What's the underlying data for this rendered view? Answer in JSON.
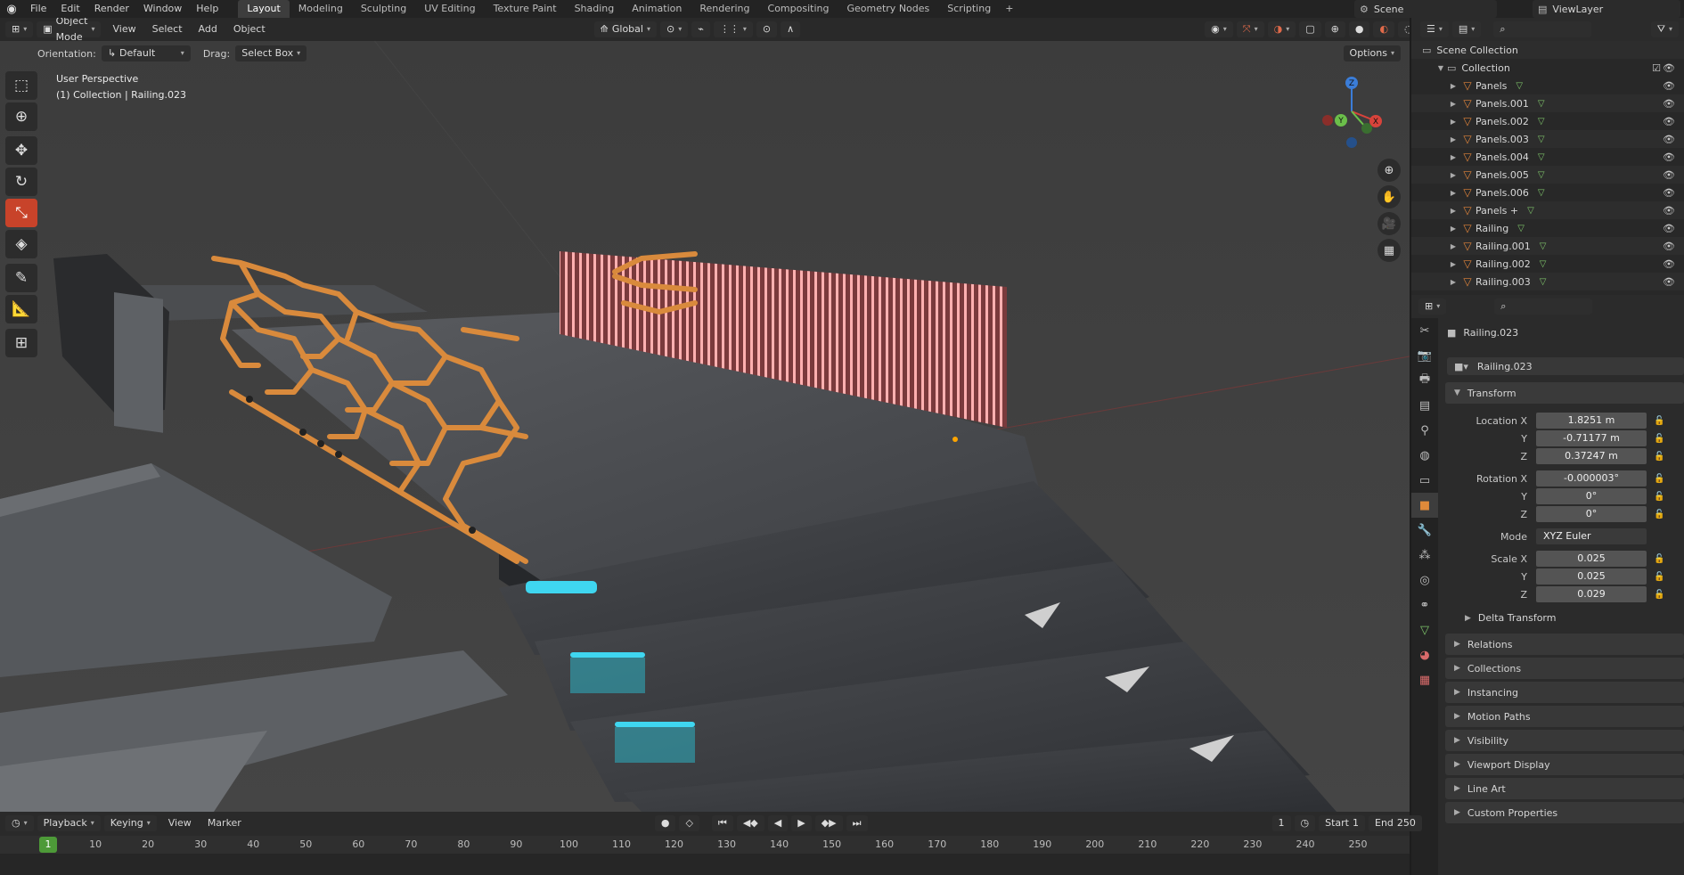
{
  "topbar": {
    "menus": [
      "File",
      "Edit",
      "Render",
      "Window",
      "Help"
    ],
    "workspaces": [
      "Layout",
      "Modeling",
      "Sculpting",
      "UV Editing",
      "Texture Paint",
      "Shading",
      "Animation",
      "Rendering",
      "Compositing",
      "Geometry Nodes",
      "Scripting"
    ],
    "active_workspace": "Layout",
    "scene": "Scene",
    "view_layer": "ViewLayer"
  },
  "viewport": {
    "mode": "Object Mode",
    "menus": [
      "View",
      "Select",
      "Add",
      "Object"
    ],
    "transform_orientation": "Global",
    "orientation_label": "Orientation:",
    "orientation_value": "Default",
    "drag_label": "Drag:",
    "drag_value": "Select Box",
    "options_label": "Options",
    "overlay_line1": "User Perspective",
    "overlay_line2": "(1) Collection | Railing.023",
    "gizmo_axes": [
      "X",
      "Y",
      "Z"
    ]
  },
  "outliner": {
    "root": "Scene Collection",
    "collection": "Collection",
    "items": [
      "Panels",
      "Panels.001",
      "Panels.002",
      "Panels.003",
      "Panels.004",
      "Panels.005",
      "Panels.006",
      "Panels +",
      "Railing",
      "Railing.001",
      "Railing.002",
      "Railing.003"
    ]
  },
  "properties": {
    "object_name": "Railing.023",
    "object_name_field": "Railing.023",
    "transform_header": "Transform",
    "location": {
      "label": "Location X",
      "x": "1.8251 m",
      "y": "-0.71177 m",
      "z": "0.37247 m"
    },
    "rotation": {
      "label": "Rotation X",
      "x": "-0.000003°",
      "y": "0°",
      "z": "0°"
    },
    "mode_label": "Mode",
    "mode_value": "XYZ Euler",
    "scale": {
      "label": "Scale X",
      "x": "0.025",
      "y": "0.025",
      "z": "0.029"
    },
    "axis_y": "Y",
    "axis_z": "Z",
    "delta_transform": "Delta Transform",
    "panels": [
      "Relations",
      "Collections",
      "Instancing",
      "Motion Paths",
      "Visibility",
      "Viewport Display",
      "Line Art",
      "Custom Properties"
    ]
  },
  "timeline": {
    "menus": [
      "Playback",
      "Keying",
      "View",
      "Marker"
    ],
    "current_frame": "1",
    "start_label": "Start",
    "start": "1",
    "end_label": "End",
    "end": "250",
    "ruler": [
      "1",
      "10",
      "20",
      "30",
      "40",
      "50",
      "60",
      "70",
      "80",
      "90",
      "100",
      "110",
      "120",
      "130",
      "140",
      "150",
      "160",
      "170",
      "180",
      "190",
      "200",
      "210",
      "220",
      "230",
      "240",
      "250"
    ]
  },
  "colors": {
    "active_tool": "#c8432a",
    "mesh_orange": "#e0843a",
    "railing_orange": "#d98a3c",
    "neon_red": "#ff6b6b",
    "neon_cyan": "#3fd6f0",
    "frame_green": "#4d9a38"
  },
  "icons": [
    "blender-logo-icon",
    "select-box-icon",
    "cursor-icon",
    "move-icon",
    "rotate-icon",
    "scale-icon",
    "transform-icon",
    "annotate-icon",
    "measure-icon",
    "add-cube-icon",
    "zoom-icon",
    "hand-icon",
    "camera-icon",
    "grid-icon",
    "eye-icon",
    "mesh-icon",
    "search-icon",
    "lock-icon"
  ]
}
